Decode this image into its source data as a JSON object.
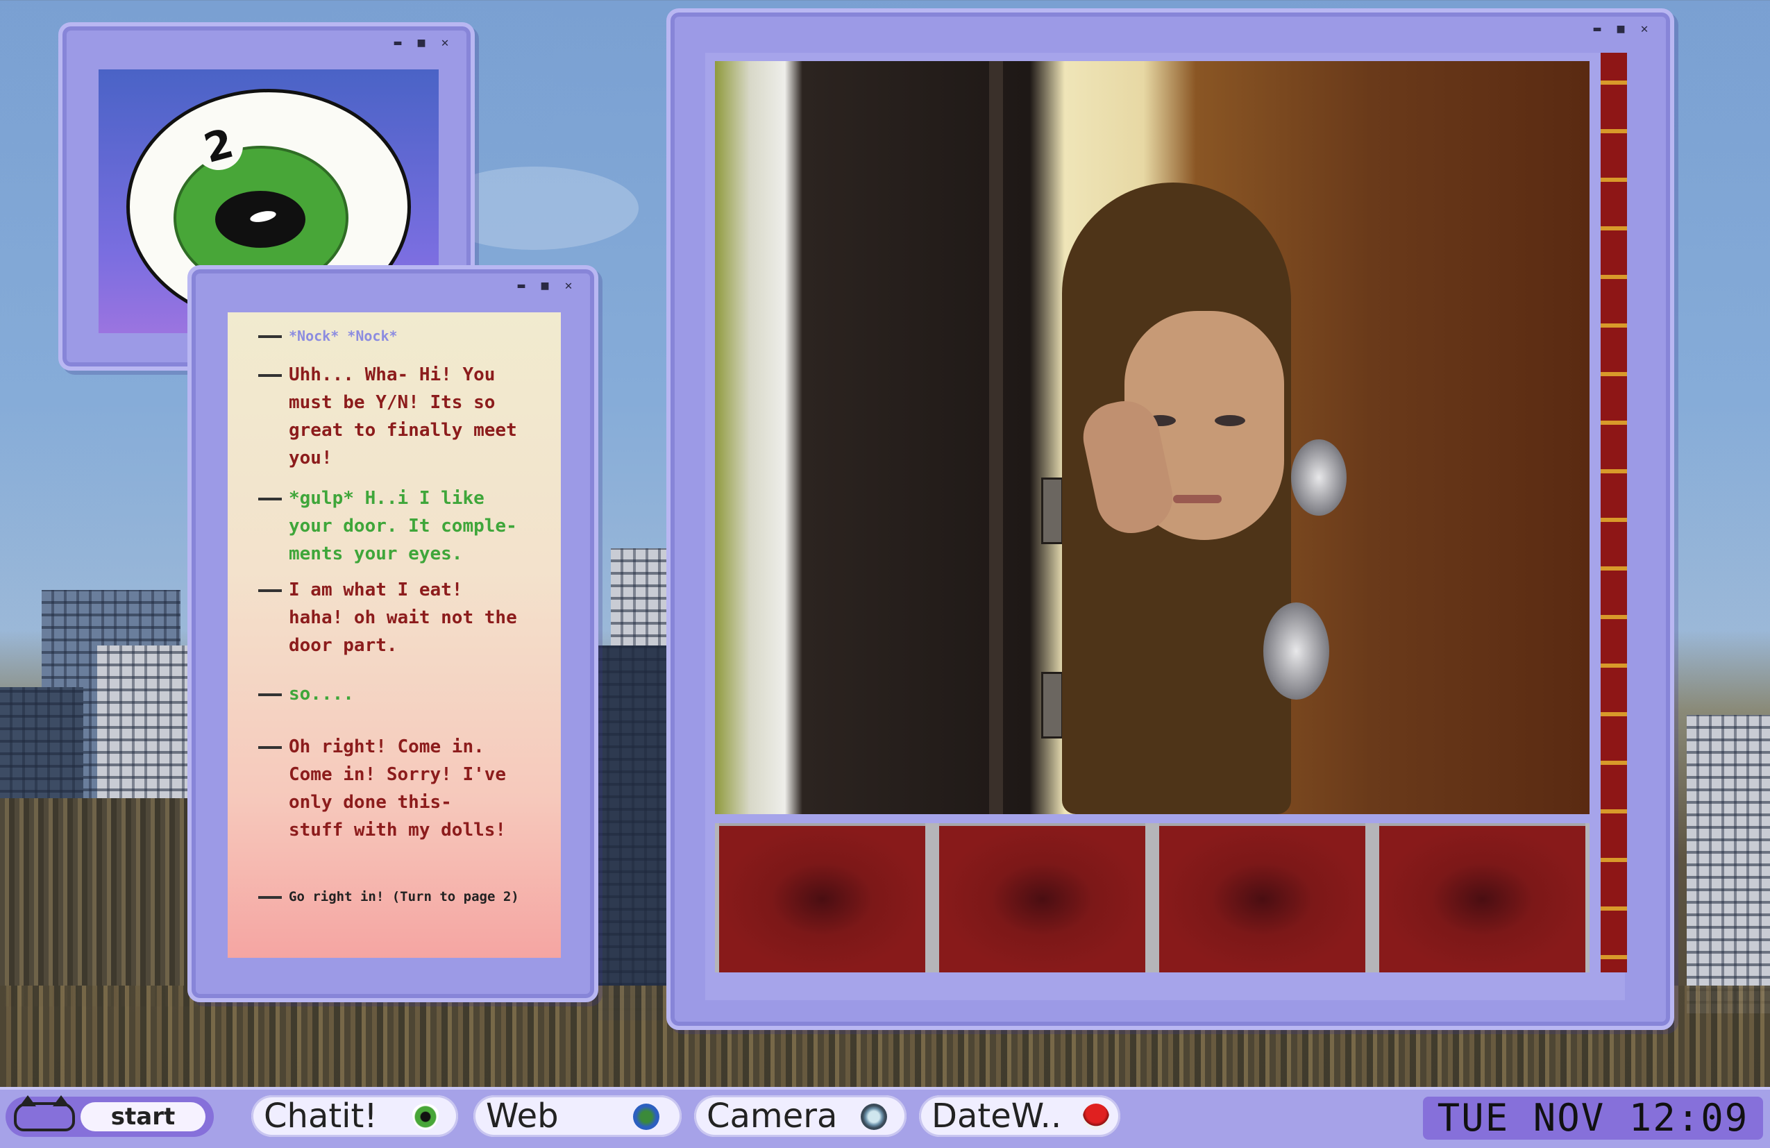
{
  "eye_window": {
    "number": "2"
  },
  "chat": {
    "messages": [
      {
        "text": "*Nock* *Nock*"
      },
      {
        "text": "Uhh... Wha- Hi! You\nmust be Y/N! Its so\ngreat to finally meet\nyou!"
      },
      {
        "text": "*gulp* H..i I like\nyour door. It comple-\nments your eyes."
      },
      {
        "text": "I am what I eat!\nhaha! oh wait not the\ndoor part."
      },
      {
        "text": "so...."
      },
      {
        "text": "Oh right! Come in.\nCome in! Sorry! I've\nonly done this-\nstuff with my dolls!"
      },
      {
        "text": "Go right in! (Turn to page 2)"
      }
    ]
  },
  "taskbar": {
    "start_label": "start",
    "apps": [
      {
        "label": "Chatit!",
        "icon": "eye-icon"
      },
      {
        "label": "Web",
        "icon": "globe-icon"
      },
      {
        "label": "Camera",
        "icon": "lens-icon"
      },
      {
        "label": "DateW..",
        "icon": "mushroom-icon"
      }
    ],
    "clock": "TUE NOV 12:09"
  },
  "window_controls": {
    "minimize": "▬",
    "maximize": "■",
    "close": "✕"
  }
}
